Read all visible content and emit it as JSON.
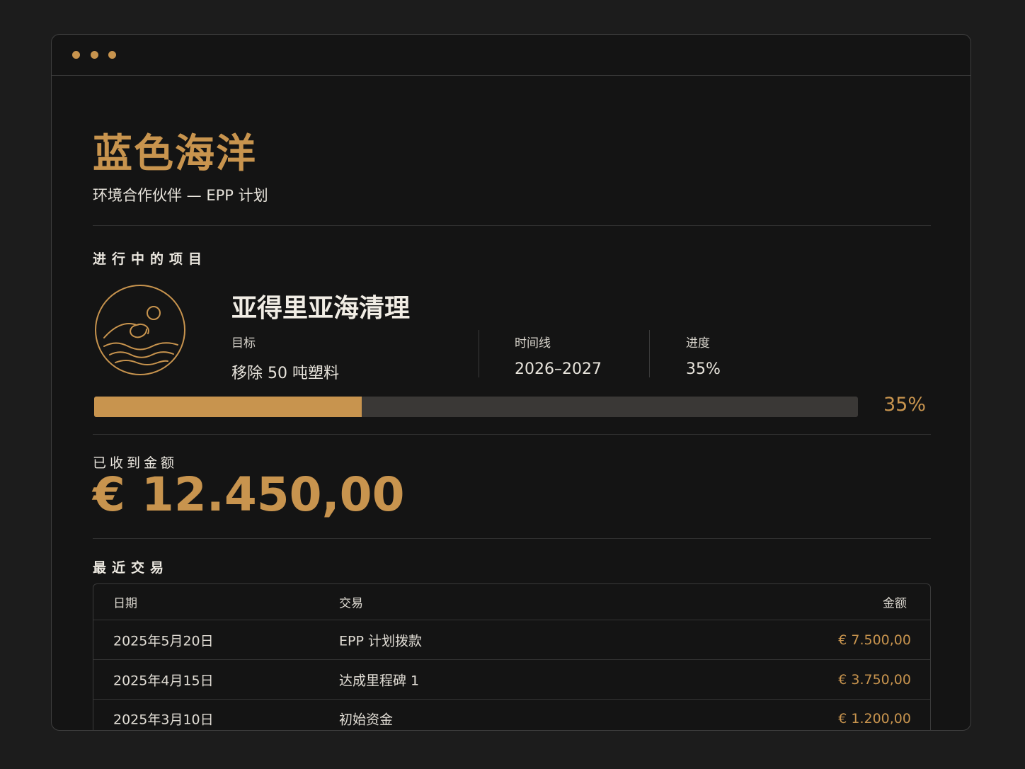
{
  "window": {
    "dot_color": "#c8944e"
  },
  "header": {
    "org_name": "蓝色海洋",
    "subtitle": "环境合作伙伴 — EPP 计划"
  },
  "active_projects": {
    "section_label": "进行中的项目",
    "emblem_icon": "ocean-wave-icon",
    "project": {
      "title": "亚得里亚海清理",
      "goal_label": "目标",
      "goal_value": "移除 50 吨塑料",
      "timeline_label": "时间线",
      "timeline_value": "2026–2027",
      "progress_label": "进度",
      "progress_value": "35%",
      "progress_percent": 35,
      "progress_display": "35%"
    }
  },
  "received": {
    "section_label": "已收到金额",
    "amount": "€ 12.450,00"
  },
  "transactions": {
    "section_label": "最近交易",
    "columns": {
      "date": "日期",
      "transaction": "交易",
      "amount": "金额"
    },
    "rows": [
      {
        "date": "2025年5月20日",
        "transaction": "EPP 计划拨款",
        "amount": "€ 7.500,00"
      },
      {
        "date": "2025年4月15日",
        "transaction": "达成里程碑 1",
        "amount": "€ 3.750,00"
      },
      {
        "date": "2025年3月10日",
        "transaction": "初始资金",
        "amount": "€ 1.200,00"
      }
    ]
  },
  "colors": {
    "accent": "#c8944e",
    "background": "#141414",
    "track": "#3a3836"
  }
}
